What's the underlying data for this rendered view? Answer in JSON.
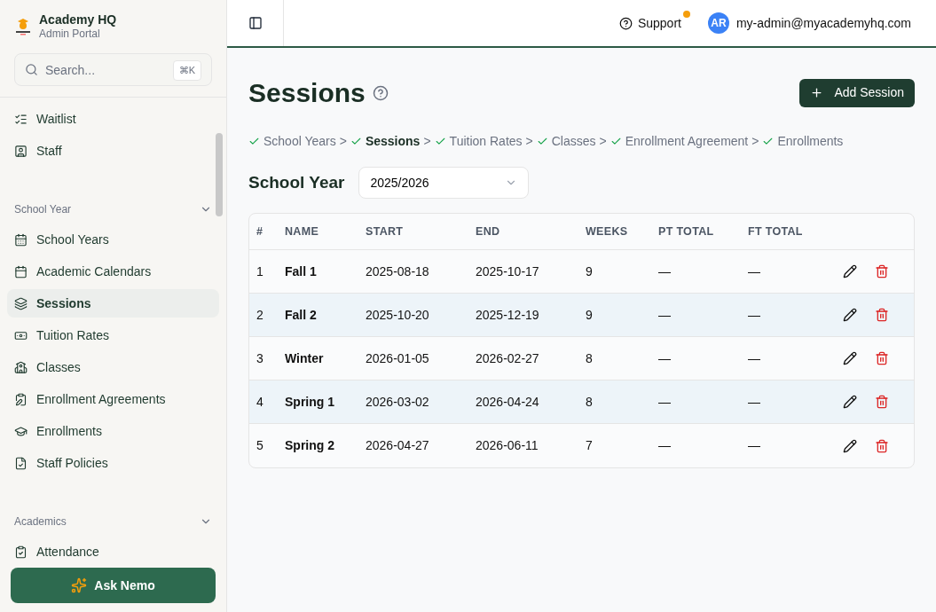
{
  "brand": {
    "title": "Academy HQ",
    "subtitle": "Admin Portal"
  },
  "search": {
    "placeholder": "Search...",
    "shortcut": "⌘K"
  },
  "sidebar": {
    "top_items": [
      {
        "label": "Waitlist",
        "selected": false
      },
      {
        "label": "Staff",
        "selected": false
      }
    ],
    "sections": [
      {
        "title": "School Year",
        "expanded": true,
        "items": [
          {
            "label": "School Years",
            "selected": false
          },
          {
            "label": "Academic Calendars",
            "selected": false
          },
          {
            "label": "Sessions",
            "selected": true
          },
          {
            "label": "Tuition Rates",
            "selected": false
          },
          {
            "label": "Classes",
            "selected": false
          },
          {
            "label": "Enrollment Agreements",
            "selected": false
          },
          {
            "label": "Enrollments",
            "selected": false
          },
          {
            "label": "Staff Policies",
            "selected": false
          }
        ]
      },
      {
        "title": "Academics",
        "expanded": true,
        "items": [
          {
            "label": "Attendance",
            "selected": false
          }
        ]
      }
    ]
  },
  "ask_button": "Ask Nemo",
  "header": {
    "support": "Support",
    "support_notification": true,
    "avatar": "AR",
    "email": "my-admin@myacademyhq.com"
  },
  "page": {
    "title": "Sessions",
    "add_button": "Add Session"
  },
  "steps": [
    {
      "label": "School Years",
      "done": true,
      "selected": false
    },
    {
      "label": "Sessions",
      "done": true,
      "selected": true
    },
    {
      "label": "Tuition Rates",
      "done": true,
      "selected": false
    },
    {
      "label": "Classes",
      "done": true,
      "selected": false
    },
    {
      "label": "Enrollment Agreement",
      "done": true,
      "selected": false
    },
    {
      "label": "Enrollments",
      "done": true,
      "selected": false
    }
  ],
  "step_separator": ">",
  "school_year": {
    "label": "School Year",
    "value": "2025/2026"
  },
  "table": {
    "columns": [
      "#",
      "NAME",
      "START",
      "END",
      "WEEKS",
      "PT TOTAL",
      "FT TOTAL"
    ],
    "rows": [
      [
        "1",
        "Fall 1",
        "2025-08-18",
        "2025-10-17",
        "9",
        "—",
        "—"
      ],
      [
        "2",
        "Fall 2",
        "2025-10-20",
        "2025-12-19",
        "9",
        "—",
        "—"
      ],
      [
        "3",
        "Winter",
        "2026-01-05",
        "2026-02-27",
        "8",
        "—",
        "—"
      ],
      [
        "4",
        "Spring 1",
        "2026-03-02",
        "2026-04-24",
        "8",
        "—",
        "—"
      ],
      [
        "5",
        "Spring 2",
        "2026-04-27",
        "2026-06-11",
        "7",
        "—",
        "—"
      ]
    ]
  }
}
